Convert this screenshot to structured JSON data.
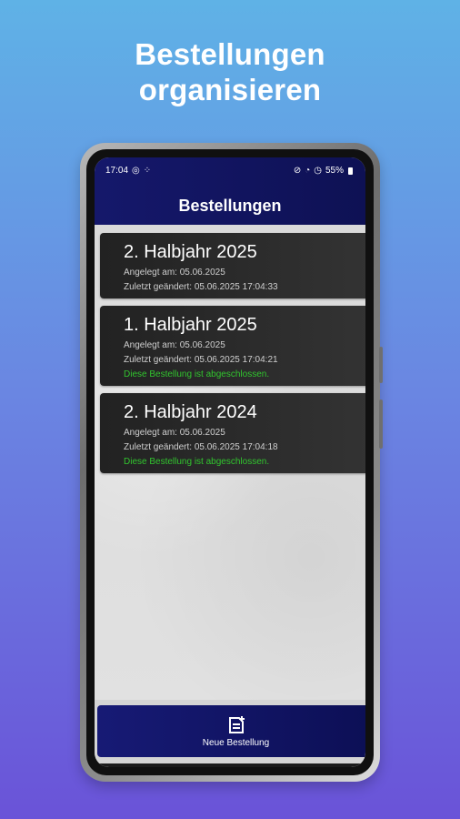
{
  "hero": {
    "line1": "Bestellungen",
    "line2": "organisieren"
  },
  "status_bar": {
    "time": "17:04",
    "battery": "55%"
  },
  "app_bar": {
    "title": "Bestellungen"
  },
  "orders": [
    {
      "title": "2. Halbjahr 2025",
      "created": "Angelegt am: 05.06.2025",
      "modified": "Zuletzt geändert: 05.06.2025 17:04:33",
      "status": ""
    },
    {
      "title": "1. Halbjahr 2025",
      "created": "Angelegt am: 05.06.2025",
      "modified": "Zuletzt geändert: 05.06.2025 17:04:21",
      "status": "Diese Bestellung ist abgeschlossen."
    },
    {
      "title": "2. Halbjahr 2024",
      "created": "Angelegt am: 05.06.2025",
      "modified": "Zuletzt geändert: 05.06.2025 17:04:18",
      "status": "Diese Bestellung ist abgeschlossen."
    }
  ],
  "bottom_action": {
    "label": "Neue Bestellung",
    "icon": "new-document-icon"
  },
  "colors": {
    "background_top": "#5fb2e6",
    "background_bottom": "#6a53d8",
    "app_bar": "#15186b",
    "card": "#2a2a2a",
    "status_ok": "#31c52e"
  }
}
